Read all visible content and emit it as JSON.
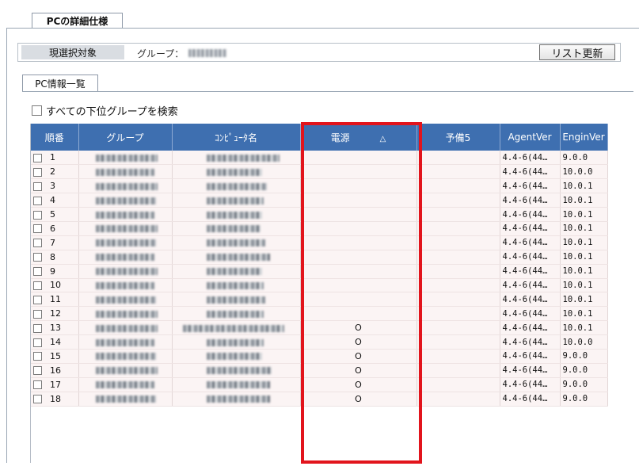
{
  "outer_tab": {
    "label": "PCの詳細仕様"
  },
  "selection": {
    "label": "現選択対象",
    "group_prefix": "グループ：",
    "refresh_button": "リスト更新"
  },
  "inner_tab": {
    "label": "PC情報一覧"
  },
  "search_all_subgroups": {
    "label": "すべての下位グループを検索",
    "checked": false
  },
  "grid": {
    "columns": [
      "順番",
      "グループ",
      "ｺﾝﾋﾟｭｰﾀ名",
      "電源",
      "予備5",
      "AgentVer",
      "EnginVer"
    ],
    "sort_indicator": "△",
    "rows": [
      {
        "num": "1",
        "power": "",
        "agent": "4.4-6(44…",
        "engine": "9.0.0"
      },
      {
        "num": "2",
        "power": "",
        "agent": "4.4-6(44…",
        "engine": "10.0.0"
      },
      {
        "num": "3",
        "power": "",
        "agent": "4.4-6(44…",
        "engine": "10.0.1"
      },
      {
        "num": "4",
        "power": "",
        "agent": "4.4-6(44…",
        "engine": "10.0.1"
      },
      {
        "num": "5",
        "power": "",
        "agent": "4.4-6(44…",
        "engine": "10.0.1"
      },
      {
        "num": "6",
        "power": "",
        "agent": "4.4-6(44…",
        "engine": "10.0.1"
      },
      {
        "num": "7",
        "power": "",
        "agent": "4.4-6(44…",
        "engine": "10.0.1"
      },
      {
        "num": "8",
        "power": "",
        "agent": "4.4-6(44…",
        "engine": "10.0.1"
      },
      {
        "num": "9",
        "power": "",
        "agent": "4.4-6(44…",
        "engine": "10.0.1"
      },
      {
        "num": "10",
        "power": "",
        "agent": "4.4-6(44…",
        "engine": "10.0.1"
      },
      {
        "num": "11",
        "power": "",
        "agent": "4.4-6(44…",
        "engine": "10.0.1"
      },
      {
        "num": "12",
        "power": "",
        "agent": "4.4-6(44…",
        "engine": "10.0.1"
      },
      {
        "num": "13",
        "power": "O",
        "agent": "4.4-6(44…",
        "engine": "10.0.1"
      },
      {
        "num": "14",
        "power": "O",
        "agent": "4.4-6(44…",
        "engine": "10.0.0"
      },
      {
        "num": "15",
        "power": "O",
        "agent": "4.4-6(44…",
        "engine": "9.0.0"
      },
      {
        "num": "16",
        "power": "O",
        "agent": "4.4-6(44…",
        "engine": "9.0.0"
      },
      {
        "num": "17",
        "power": "O",
        "agent": "4.4-6(44…",
        "engine": "9.0.0"
      },
      {
        "num": "18",
        "power": "O",
        "agent": "4.4-6(44…",
        "engine": "9.0.0"
      }
    ]
  },
  "colors": {
    "header_bg": "#3e6fb0",
    "row_bg": "#fbf4f4",
    "highlight": "#e2141c"
  }
}
